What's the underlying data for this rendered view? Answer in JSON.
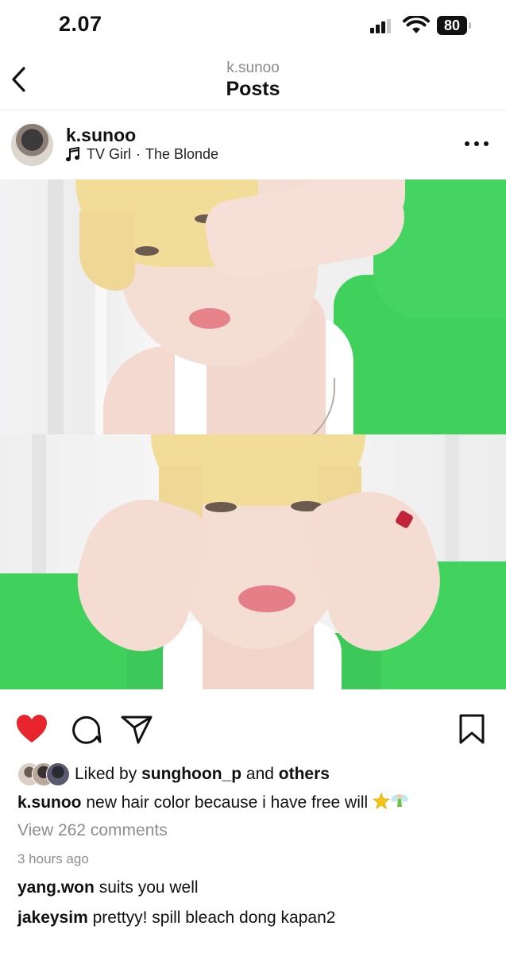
{
  "status_bar": {
    "time": "2.07",
    "battery": "80"
  },
  "header": {
    "subtitle": "k.sunoo",
    "title": "Posts"
  },
  "post": {
    "username": "k.sunoo",
    "music": {
      "artist": "TV Girl",
      "separator": "·",
      "song": "The Blonde"
    },
    "image_colors": {
      "hair": "#f2dd98",
      "skin": "#f3d9cf",
      "sweater": "#3fd15c",
      "tank": "#ffffff",
      "backdrop": "#efefef"
    },
    "liked": true,
    "likes": {
      "prefix": "Liked by",
      "user": "sunghoon_p",
      "connector": "and",
      "others": "others"
    },
    "caption": {
      "user": "k.sunoo",
      "text": "new hair color because i have free will"
    },
    "view_comments": "View 262 comments",
    "timestamp": "3 hours ago",
    "comments": [
      {
        "user": "yang.won",
        "text": "suits you well"
      },
      {
        "user": "jakeysim",
        "text": "prettyy! spill bleach dong kapan2"
      }
    ]
  },
  "colors": {
    "like": "#e8252d",
    "muted_text": "#8e8e8e"
  },
  "icons": [
    "back-chevron-icon",
    "music-note-icon",
    "more-icon",
    "heart-icon",
    "comment-icon",
    "share-icon",
    "bookmark-icon",
    "star-emoji-icon",
    "fairy-emoji-icon"
  ]
}
